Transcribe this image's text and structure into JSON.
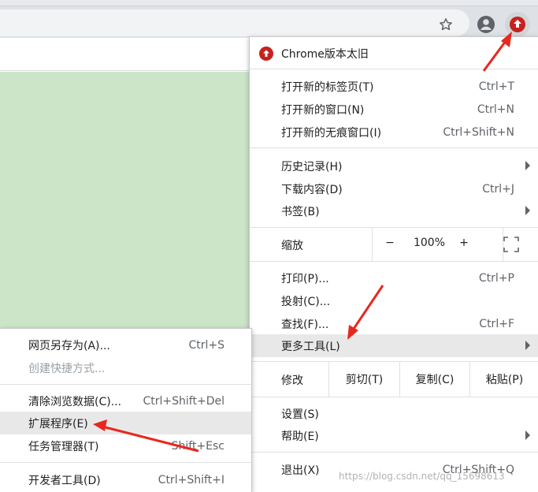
{
  "toolbar": {
    "icons": [
      "star-icon",
      "account-circle-icon",
      "update-arrow-icon"
    ],
    "update_color": "#c5221f"
  },
  "main_menu": {
    "header": "Chrome版本太旧",
    "group1": [
      {
        "label": "打开新的标签页(T)",
        "shortcut": "Ctrl+T"
      },
      {
        "label": "打开新的窗口(N)",
        "shortcut": "Ctrl+N"
      },
      {
        "label": "打开新的无痕窗口(I)",
        "shortcut": "Ctrl+Shift+N"
      }
    ],
    "group2": [
      {
        "label": "历史记录(H)",
        "shortcut": ""
      },
      {
        "label": "下载内容(D)",
        "shortcut": "Ctrl+J"
      },
      {
        "label": "书签(B)",
        "shortcut": ""
      }
    ],
    "zoom": {
      "label": "缩放",
      "minus": "−",
      "value": "100%",
      "plus": "+"
    },
    "group3": [
      {
        "label": "打印(P)...",
        "shortcut": "Ctrl+P"
      },
      {
        "label": "投射(C)...",
        "shortcut": ""
      },
      {
        "label": "查找(F)...",
        "shortcut": "Ctrl+F"
      },
      {
        "label": "更多工具(L)",
        "shortcut": ""
      }
    ],
    "edit": {
      "label": "修改",
      "cut": "剪切(T)",
      "copy": "复制(C)",
      "paste": "粘贴(P)"
    },
    "group4": [
      {
        "label": "设置(S)",
        "shortcut": ""
      },
      {
        "label": "帮助(E)",
        "shortcut": ""
      }
    ],
    "exit": {
      "label": "退出(X)",
      "shortcut": "Ctrl+Shift+Q"
    }
  },
  "sub_menu": {
    "items": [
      {
        "label": "网页另存为(A)...",
        "shortcut": "Ctrl+S"
      },
      {
        "label": "创建快捷方式...",
        "shortcut": ""
      },
      {
        "label": "清除浏览数据(C)...",
        "shortcut": "Ctrl+Shift+Del"
      },
      {
        "label": "扩展程序(E)",
        "shortcut": ""
      },
      {
        "label": "任务管理器(T)",
        "shortcut": "Shift+Esc"
      },
      {
        "label": "开发者工具(D)",
        "shortcut": "Ctrl+Shift+I"
      }
    ]
  },
  "watermark": "https://blog.csdn.net/qq_15698613",
  "colors": {
    "highlight": "#e8e8e8",
    "page_bg": "#cce5c9",
    "annotation": "#e8281e"
  }
}
